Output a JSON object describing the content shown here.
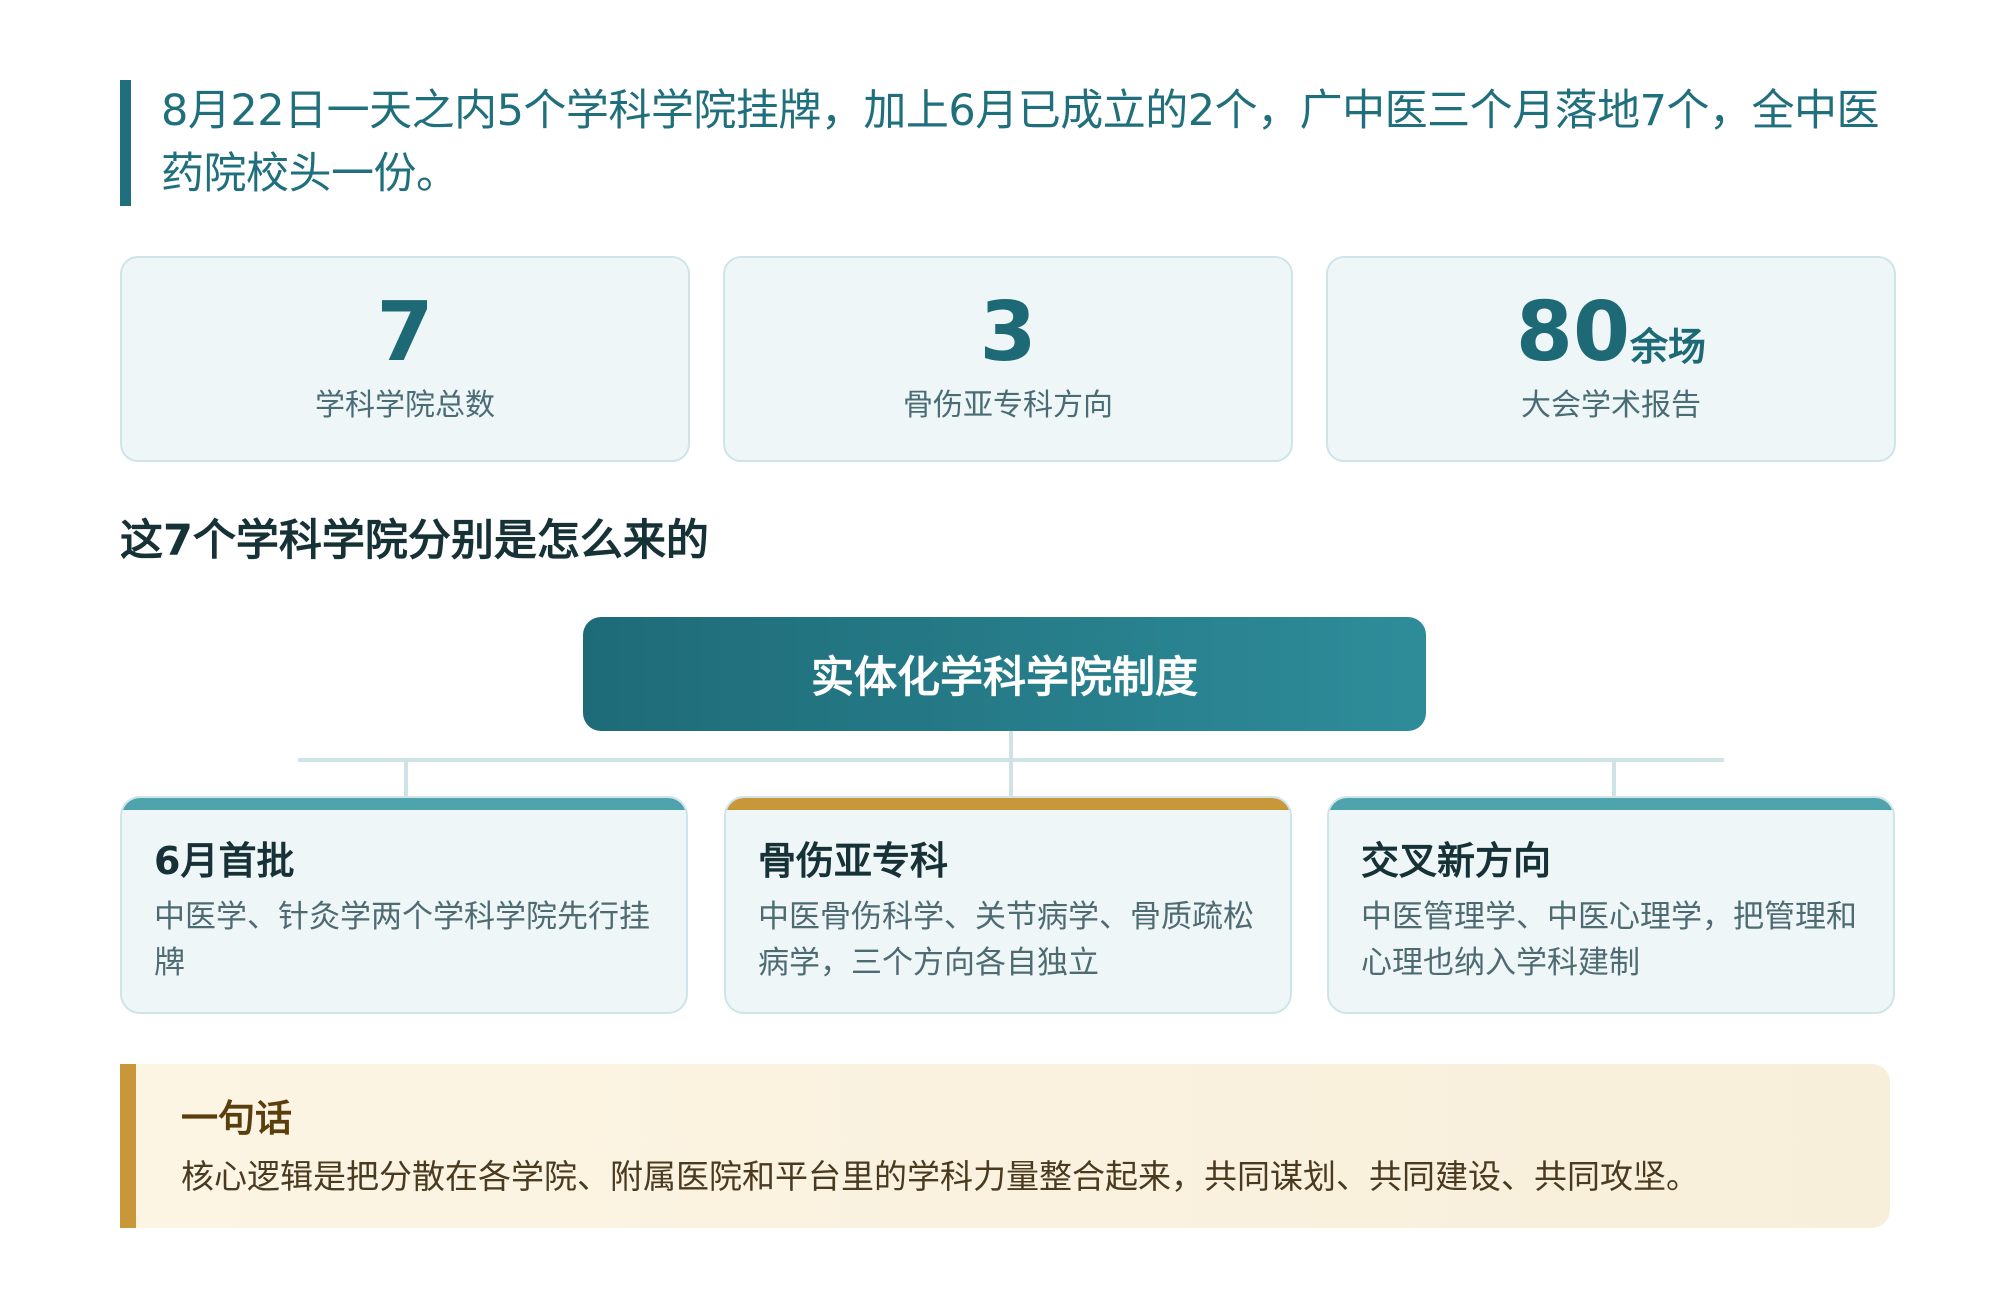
{
  "intro": {
    "text": "8月22日一天之内5个学科学院挂牌，加上6月已成立的2个，广中医三个月落地7个，全中医药院校头一份。"
  },
  "stats": [
    {
      "value": "7",
      "unit": "",
      "label": "学科学院总数"
    },
    {
      "value": "3",
      "unit": "",
      "label": "骨伤亚专科方向"
    },
    {
      "value": "80",
      "unit": "余场",
      "label": "大会学术报告"
    }
  ],
  "section": {
    "title": "这7个学科学院分别是怎么来的"
  },
  "diagram": {
    "root": "实体化学科学院制度",
    "branches": [
      {
        "title": "6月首批",
        "desc": "中医学、针灸学两个学科学院先行挂牌",
        "accent": "#4ea3ad"
      },
      {
        "title": "骨伤亚专科",
        "desc": "中医骨伤科学、关节病学、骨质疏松病学，三个方向各自独立",
        "accent": "#c8973a"
      },
      {
        "title": "交叉新方向",
        "desc": "中医管理学、中医心理学，把管理和心理也纳入学科建制",
        "accent": "#4ea3ad"
      }
    ]
  },
  "summary": {
    "title": "一句话",
    "text": "核心逻辑是把分散在各学院、附属医院和平台里的学科力量整合起来，共同谋划、共同建设、共同攻坚。"
  },
  "colors": {
    "primary": "#1f6f7c",
    "gold": "#c8973a",
    "card_bg": "#eef6f8"
  }
}
